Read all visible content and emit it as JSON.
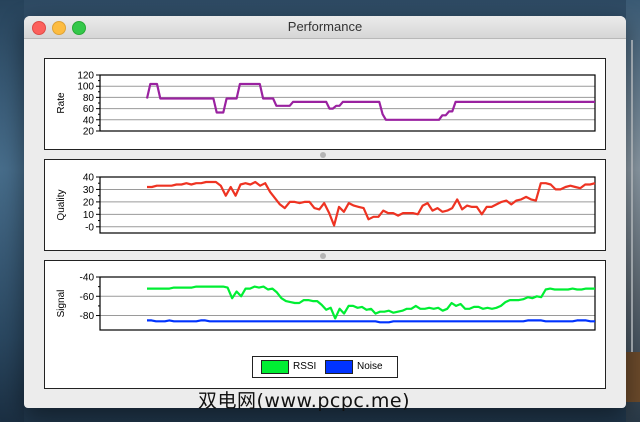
{
  "window": {
    "title": "Performance"
  },
  "traffic_lights": {
    "close": "close-button",
    "minimize": "minimize-button",
    "zoom": "zoom-button"
  },
  "legend": [
    {
      "label": "RSSI",
      "color": "#00ee33"
    },
    {
      "label": "Noise",
      "color": "#0033ff"
    }
  ],
  "watermark": "双电网(www.pcpc.me)",
  "chart_data": [
    {
      "type": "line",
      "ylabel": "Rate",
      "ylim": [
        20,
        120
      ],
      "yticks": [
        120,
        100,
        80,
        60,
        40,
        20
      ],
      "grid": true,
      "series": [
        {
          "color": "#9a22a0",
          "values": [
            78,
            104,
            104,
            104,
            78,
            78,
            78,
            78,
            78,
            78,
            78,
            78,
            78,
            78,
            78,
            78,
            78,
            78,
            78,
            78,
            78,
            53,
            53,
            53,
            78,
            78,
            78,
            78,
            104,
            104,
            104,
            104,
            104,
            104,
            104,
            78,
            78,
            78,
            78,
            65,
            65,
            65,
            65,
            65,
            72,
            72,
            72,
            72,
            72,
            72,
            72,
            72,
            72,
            72,
            72,
            60,
            60,
            65,
            65,
            72,
            72,
            72,
            72,
            72,
            72,
            72,
            72,
            72,
            72,
            72,
            72,
            50,
            40,
            40,
            40,
            40,
            40,
            40,
            40,
            40,
            40,
            40,
            40,
            40,
            40,
            40,
            40,
            40,
            40,
            48,
            48,
            55,
            55,
            72,
            72,
            72,
            72,
            72,
            72,
            72,
            72,
            72,
            72,
            72,
            72,
            72,
            72,
            72,
            72,
            72,
            72,
            72,
            72,
            72,
            72,
            72,
            72,
            72,
            72,
            72,
            72,
            72,
            72,
            72,
            72,
            72,
            72,
            72,
            72,
            72,
            72,
            72,
            72,
            72,
            72,
            72
          ]
        }
      ]
    },
    {
      "type": "line",
      "ylabel": "Quality",
      "ylim": [
        -5,
        40
      ],
      "yticks": [
        40,
        30,
        20,
        10,
        0
      ],
      "ytick_labels": [
        "40",
        "30",
        "20",
        "10",
        "-0"
      ],
      "grid": true,
      "series": [
        {
          "color": "#ee3322",
          "values": [
            32,
            32,
            33,
            33,
            33,
            33,
            34,
            34,
            35,
            34,
            35,
            35,
            36,
            36,
            36,
            33,
            25,
            32,
            25,
            34,
            35,
            34,
            36,
            33,
            35,
            28,
            23,
            18,
            15,
            20,
            20,
            19,
            20,
            20,
            15,
            14,
            19,
            11,
            1,
            16,
            12,
            19,
            17,
            16,
            15,
            6,
            8,
            8,
            13,
            11,
            11,
            9,
            11,
            11,
            11,
            10,
            17,
            19,
            13,
            15,
            12,
            13,
            15,
            22,
            14,
            17,
            16,
            16,
            10,
            16,
            16,
            18,
            20,
            21,
            18,
            21,
            22,
            24,
            22,
            21,
            35,
            35,
            34,
            30,
            30,
            32,
            33,
            32,
            31,
            34,
            34,
            35
          ]
        }
      ]
    },
    {
      "type": "line",
      "ylabel": "Signal",
      "ylim": [
        -95,
        -40
      ],
      "yticks": [
        -40,
        -60,
        -80
      ],
      "grid": true,
      "series": [
        {
          "name": "RSSI",
          "color": "#00ee33",
          "values": [
            -52,
            -52,
            -52,
            -52,
            -52,
            -52,
            -51,
            -51,
            -51,
            -51,
            -51,
            -50,
            -50,
            -50,
            -50,
            -50,
            -50,
            -50,
            -51,
            -62,
            -55,
            -60,
            -52,
            -52,
            -50,
            -51,
            -50,
            -53,
            -52,
            -56,
            -62,
            -65,
            -66,
            -67,
            -67,
            -64,
            -64,
            -65,
            -65,
            -69,
            -74,
            -72,
            -83,
            -73,
            -78,
            -70,
            -70,
            -72,
            -71,
            -74,
            -73,
            -78,
            -76,
            -76,
            -75,
            -77,
            -76,
            -75,
            -73,
            -73,
            -70,
            -73,
            -73,
            -72,
            -73,
            -72,
            -75,
            -73,
            -67,
            -70,
            -68,
            -73,
            -73,
            -71,
            -71,
            -73,
            -72,
            -73,
            -72,
            -70,
            -66,
            -64,
            -64,
            -64,
            -63,
            -61,
            -62,
            -60,
            -61,
            -53,
            -52,
            -53,
            -53,
            -53,
            -53,
            -52,
            -53,
            -53,
            -52,
            -52,
            -52
          ]
        },
        {
          "name": "Noise",
          "color": "#0033ff",
          "values": [
            -85,
            -85,
            -86,
            -86,
            -86,
            -85,
            -86,
            -86,
            -86,
            -86,
            -86,
            -86,
            -85,
            -85,
            -86,
            -86,
            -86,
            -86,
            -86,
            -86,
            -86,
            -86,
            -86,
            -86,
            -86,
            -86,
            -86,
            -86,
            -86,
            -86,
            -86,
            -86,
            -86,
            -86,
            -86,
            -86,
            -86,
            -86,
            -86,
            -86,
            -86,
            -86,
            -86,
            -86,
            -86,
            -86,
            -86,
            -86,
            -86,
            -86,
            -86,
            -86,
            -87,
            -87,
            -87,
            -86,
            -86,
            -86,
            -86,
            -86,
            -86,
            -86,
            -86,
            -86,
            -86,
            -86,
            -86,
            -86,
            -86,
            -86,
            -86,
            -86,
            -86,
            -86,
            -86,
            -86,
            -86,
            -86,
            -86,
            -86,
            -86,
            -86,
            -86,
            -86,
            -86,
            -85,
            -85,
            -85,
            -85,
            -86,
            -86,
            -86,
            -86,
            -86,
            -86,
            -86,
            -85,
            -85,
            -85,
            -86,
            -86
          ]
        }
      ]
    }
  ]
}
